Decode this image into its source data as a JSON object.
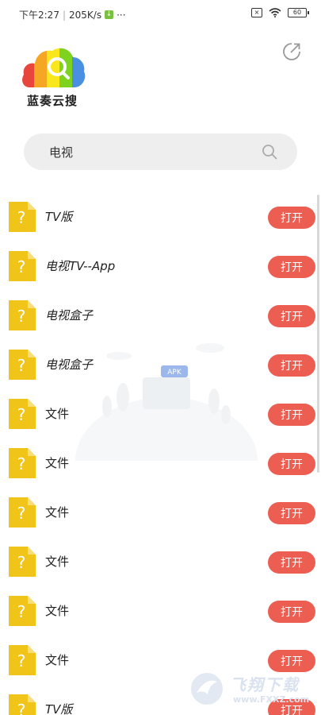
{
  "status": {
    "time": "下午2:27",
    "speed": "205K/s",
    "battery": "60"
  },
  "app": {
    "name": "蓝奏云搜"
  },
  "search": {
    "value": "电视"
  },
  "items": [
    {
      "name": "TV版",
      "italic": true,
      "button": "打开"
    },
    {
      "name": "电视TV--App",
      "italic": true,
      "button": "打开"
    },
    {
      "name": "电视盒子",
      "italic": true,
      "button": "打开"
    },
    {
      "name": "电视盒子",
      "italic": true,
      "button": "打开"
    },
    {
      "name": "文件",
      "italic": false,
      "button": "打开"
    },
    {
      "name": "文件",
      "italic": false,
      "button": "打开"
    },
    {
      "name": "文件",
      "italic": false,
      "button": "打开"
    },
    {
      "name": "文件",
      "italic": false,
      "button": "打开"
    },
    {
      "name": "文件",
      "italic": false,
      "button": "打开"
    },
    {
      "name": "文件",
      "italic": false,
      "button": "打开"
    },
    {
      "name": "TV版",
      "italic": true,
      "button": "打开"
    }
  ],
  "illustration": {
    "badge": "APK"
  },
  "watermark": {
    "text": "飞翔下载",
    "url": "www.FXXZ.com"
  },
  "colors": {
    "accent": "#ec5e52",
    "file_icon": "#f0c419",
    "search_bg": "#eeeeee"
  }
}
